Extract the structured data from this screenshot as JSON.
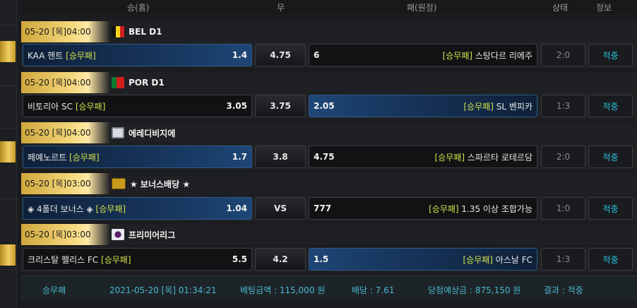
{
  "header": {
    "home": "승(홈)",
    "draw": "무",
    "away": "패(원정)",
    "status": "상태",
    "info": "정보"
  },
  "matches": [
    {
      "datetime": "05-20 [목]04:00",
      "league": "BEL D1",
      "home_team": "KAA 헨트",
      "home_tag": "[승무패]",
      "home_odds": "1.4",
      "draw": "4.75",
      "away_odds": "6",
      "away_tag": "[승무패]",
      "away_team": "스탕다르 리에주",
      "score": "2:0",
      "result": "적중",
      "selected": "home"
    },
    {
      "datetime": "05-20 [목]04:00",
      "league": "POR D1",
      "home_team": "비토리아 SC",
      "home_tag": "[승무패]",
      "home_odds": "3.05",
      "draw": "3.75",
      "away_odds": "2.05",
      "away_tag": "[승무패]",
      "away_team": "SL 벤피카",
      "score": "1:3",
      "result": "적중",
      "selected": "away"
    },
    {
      "datetime": "05-20 [목]04:00",
      "league": "에레디비지에",
      "home_team": "페예노르트",
      "home_tag": "[승무패]",
      "home_odds": "1.7",
      "draw": "3.8",
      "away_odds": "4.75",
      "away_tag": "[승무패]",
      "away_team": "스파르타 로테르담",
      "score": "2:0",
      "result": "적중",
      "selected": "home"
    },
    {
      "datetime": "05-20 [목]03:00",
      "league": "★ 보너스배당 ★",
      "home_team": "◈ 4폴더 보너스 ◈",
      "home_tag": "[승무패]",
      "home_odds": "1.04",
      "draw": "VS",
      "away_odds": "777",
      "away_tag": "[승무패]",
      "away_team": "1.35 이상 조합가능",
      "score": "1:0",
      "result": "적중",
      "selected": "home"
    },
    {
      "datetime": "05-20 [목]03:00",
      "league": "프리미어리그",
      "home_team": "크리스탈 팰리스 FC",
      "home_tag": "[승무패]",
      "home_odds": "5.5",
      "draw": "4.2",
      "away_odds": "1.5",
      "away_tag": "[승무패]",
      "away_team": "아스날 FC",
      "score": "1:3",
      "result": "적중",
      "selected": "away"
    }
  ],
  "footer": {
    "type": "승무패",
    "datetime": "2021-05-20 [목] 01:34:21",
    "bet_amount": "베팅금액 : 115,000 원",
    "odds": "배당 : 7.61",
    "expected": "당첨예상금 : 875,150 원",
    "result": "결과 : 적중"
  },
  "colors": {
    "gold": "#f3d67a",
    "accent_blue": "#1e4675",
    "tag_yellow": "#d5e34a",
    "info_cyan": "#29c6e6"
  },
  "league_icons": [
    "belgium-flag-icon",
    "portugal-flag-icon",
    "eredivisie-logo-icon",
    "bonus-icon",
    "premier-league-logo-icon"
  ]
}
